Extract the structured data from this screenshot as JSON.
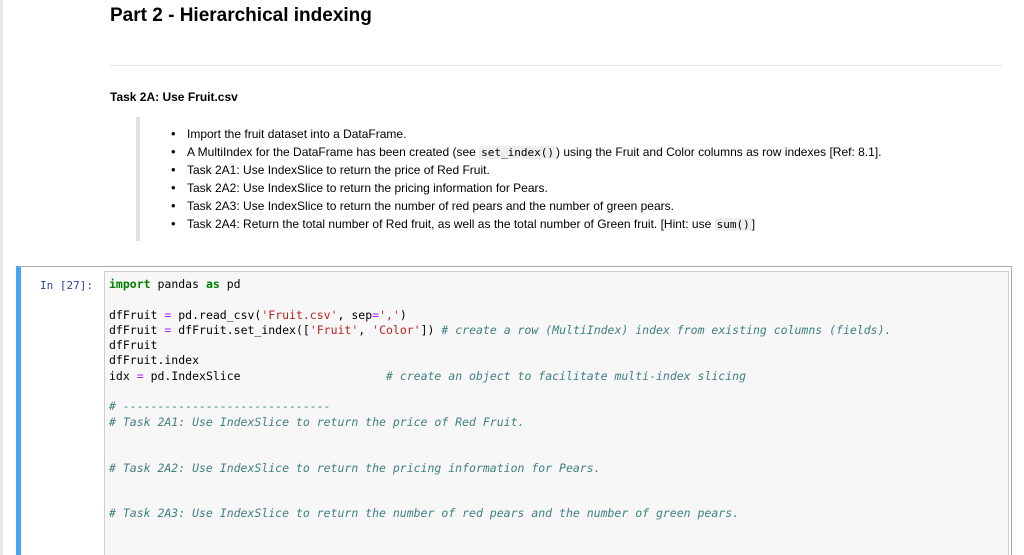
{
  "notebook": {
    "title": "Part 2 - Hierarchical indexing",
    "task_heading": "Task 2A: Use Fruit.csv",
    "bullets": [
      {
        "text": "Import the fruit dataset into a DataFrame."
      },
      {
        "pre": "A MultiIndex for the DataFrame has been created (see ",
        "code": "set_index()",
        "post": ") using the Fruit and Color columns as row indexes [Ref: 8.1]."
      },
      {
        "text": "Task 2A1: Use IndexSlice to return the price of Red Fruit."
      },
      {
        "text": "Task 2A2: Use IndexSlice to return the pricing information for Pears."
      },
      {
        "text": "Task 2A3: Use IndexSlice to return the number of red pears and the number of green pears."
      },
      {
        "pre": "Task 2A4: Return the total number of Red fruit, as well as the total number of Green fruit. [Hint: use ",
        "code": "sum()",
        "post": "]"
      }
    ]
  },
  "code_cell": {
    "prompt": "In [27]:",
    "line1": {
      "kw_import": "import",
      "mod": " pandas ",
      "kw_as": "as",
      "alias": " pd"
    },
    "line2": {
      "a": "dfFruit ",
      "eq": "=",
      "b": " pd.read_csv(",
      "s1": "'Fruit.csv'",
      "c": ", sep",
      "eq2": "=",
      "s2": "','",
      "d": ")"
    },
    "line3": {
      "a": "dfFruit ",
      "eq": "=",
      "b": " dfFruit.set_index([",
      "s1": "'Fruit'",
      "c": ", ",
      "s2": "'Color'",
      "d": "]) ",
      "comment": "# create a row (MultiIndex) index from existing columns (fields)."
    },
    "line4": "dfFruit",
    "line5": "dfFruit.index",
    "line6": {
      "a": "idx ",
      "eq": "=",
      "b": " pd.IndexSlice                     ",
      "comment": "# create an object to facilitate multi-index slicing"
    },
    "comment_rule": "# ------------------------------",
    "comment_2a1": "# Task 2A1: Use IndexSlice to return the price of Red Fruit.",
    "comment_2a2": "# Task 2A2: Use IndexSlice to return the pricing information for Pears.",
    "comment_2a3": "# Task 2A3: Use IndexSlice to return the number of red pears and the number of green pears."
  },
  "colors": {
    "selected_cell_border": "#42a5f5",
    "prompt": "#303f9f",
    "keyword": "#008000",
    "string": "#ba2121",
    "comment": "#408080",
    "operator": "#aa22ff"
  }
}
